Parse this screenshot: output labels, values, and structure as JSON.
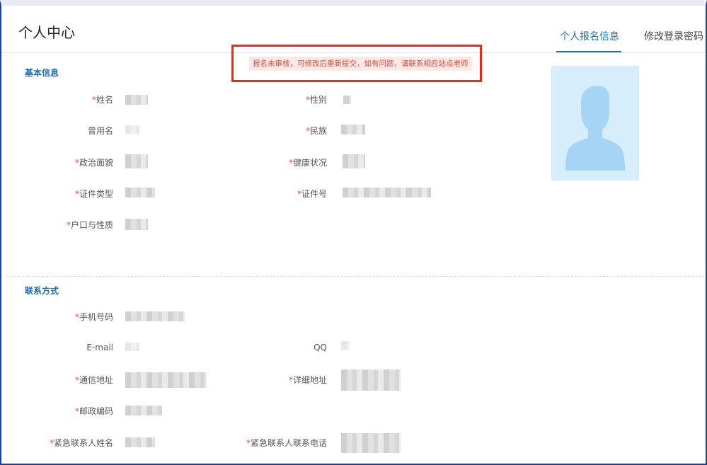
{
  "header": {
    "title": "个人中心",
    "tabs": [
      {
        "label": "个人报名信息",
        "active": true
      },
      {
        "label": "修改登录密码",
        "active": false
      }
    ]
  },
  "notice": {
    "text": "报名未审核，可修改后重新提交，如有问题，请联系相应站点老师"
  },
  "sections": {
    "basic": {
      "title": "基本信息",
      "fields": {
        "name": {
          "label": "姓名",
          "required": "*"
        },
        "gender": {
          "label": "性别",
          "required": "*"
        },
        "former_name": {
          "label": "曾用名"
        },
        "ethnicity": {
          "label": "民族",
          "required": "*"
        },
        "political": {
          "label": "政治面貌",
          "required": "*"
        },
        "health": {
          "label": "健康状况",
          "required": "*"
        },
        "id_type": {
          "label": "证件类型",
          "required": "*"
        },
        "id_number": {
          "label": "证件号",
          "required": "*"
        },
        "household": {
          "label": "户口与性质",
          "required": "*"
        }
      }
    },
    "contact": {
      "title": "联系方式",
      "fields": {
        "phone": {
          "label": "手机号码",
          "required": "*"
        },
        "email": {
          "label": "E-mail"
        },
        "qq": {
          "label": "QQ"
        },
        "mail_address": {
          "label": "通信地址",
          "required": "*"
        },
        "detail_address": {
          "label": "详细地址",
          "required": "*"
        },
        "postcode": {
          "label": "邮政编码",
          "required": "*"
        },
        "emergency_name": {
          "label": "紧急联系人姓名",
          "required": "*"
        },
        "emergency_phone": {
          "label": "紧急联系人联系电话",
          "required": "*"
        }
      }
    }
  },
  "colors": {
    "accent": "#1a6fb8",
    "required": "#e2483e",
    "notice_border": "#ee2a12",
    "avatar_bg": "#d6edfb",
    "avatar_fg": "#a6d4f4"
  },
  "icons": {
    "avatar": "user-silhouette-icon"
  }
}
